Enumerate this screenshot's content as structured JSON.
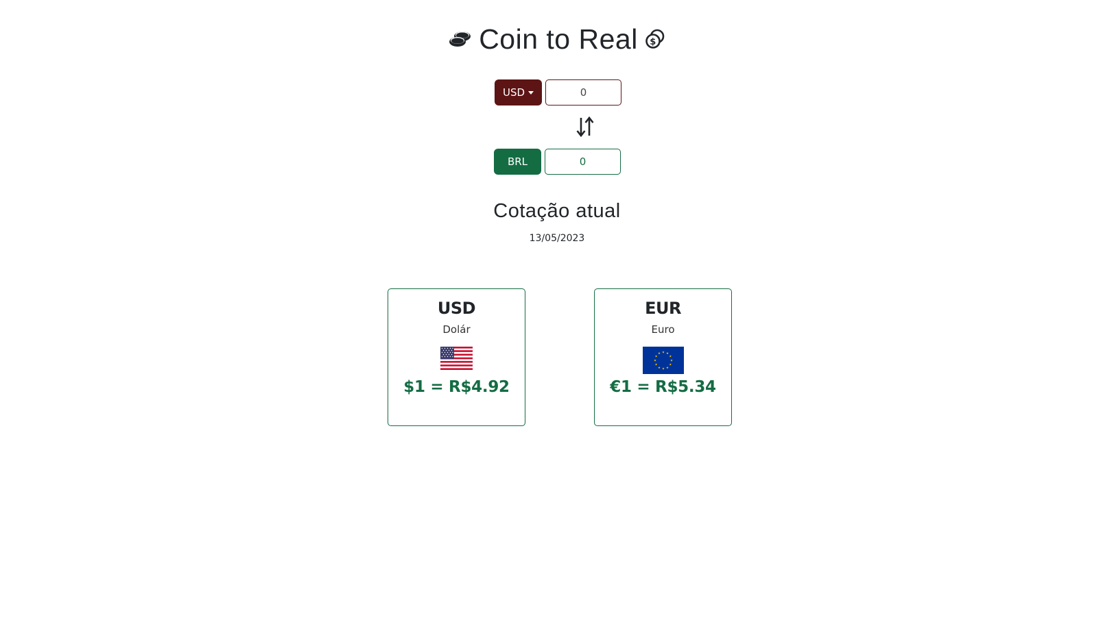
{
  "header": {
    "title": "Coin to Real",
    "left_icon": "coins-stack-icon",
    "right_icon": "coins-dollar-icon"
  },
  "converter": {
    "from_currency_label": "USD",
    "from_amount": "0",
    "to_currency_label": "BRL",
    "to_amount": "0",
    "swap_icon": "arrow-down-up-icon",
    "from_color": "#5c1414",
    "to_color": "#146c43"
  },
  "quotes": {
    "title": "Cotação atual",
    "date": "13/05/2023",
    "cards": [
      {
        "code": "USD",
        "name": "Dolár",
        "flag": "us-flag-icon",
        "rate_text": "$1 = R$4.92"
      },
      {
        "code": "EUR",
        "name": "Euro",
        "flag": "eu-flag-icon",
        "rate_text": "€1 = R$5.34"
      }
    ],
    "accent_color": "#146c43"
  }
}
